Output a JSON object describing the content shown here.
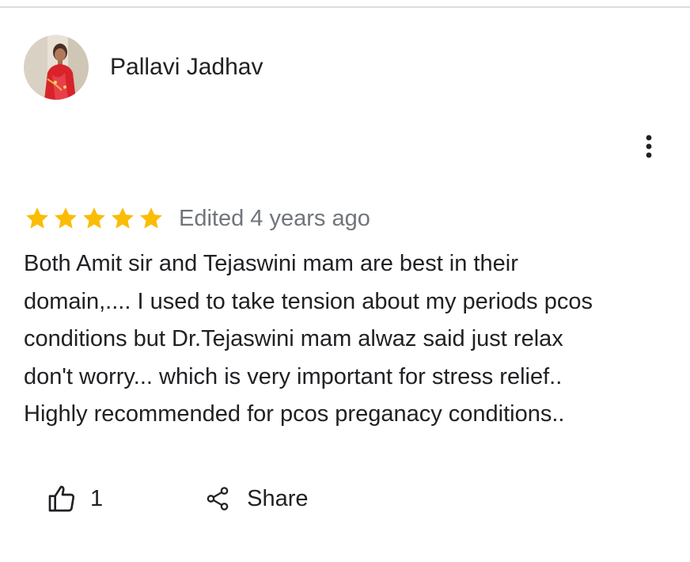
{
  "reviewer": {
    "name": "Pallavi Jadhav",
    "avatar_icon": "profile-photo"
  },
  "more_options_icon": "more-vert-icon",
  "rating": {
    "stars": 5,
    "max_stars": 5,
    "star_color": "#fbbc04",
    "date": "Edited 4 years ago"
  },
  "review_lines": [
    "Both Amit sir and Tejaswini mam are best in their",
    "domain,.... I used to take tension about my periods pcos",
    "conditions but Dr.Tejaswini mam alwaz said just relax",
    "don't worry... which is very important for stress relief..",
    "Highly recommended for pcos preganacy conditions.."
  ],
  "actions": {
    "like_icon": "thumbs-up-icon",
    "like_count": "1",
    "share_icon": "share-icon",
    "share_label": "Share"
  },
  "colors": {
    "text": "#202124",
    "secondary_text": "#70757a",
    "divider": "#dadce0"
  }
}
